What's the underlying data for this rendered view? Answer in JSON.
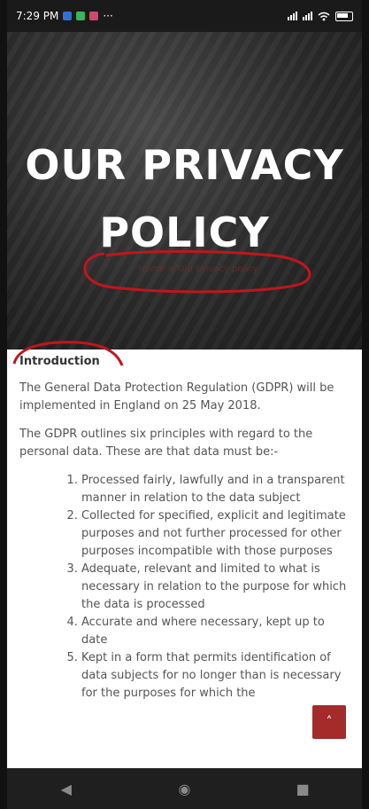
{
  "status_bar": {
    "time": "7:29 PM",
    "dots": "···"
  },
  "hero": {
    "title_line1": "OUR PRIVACY",
    "title_line2": "POLICY",
    "subtitle": "Home > Our privacy policy"
  },
  "content": {
    "section_title": "Introduction",
    "para1": "The General Data Protection Regulation (GDPR) will be implemented in England on 25 May 2018.",
    "para2": "The GDPR outlines six principles with regard to the personal data.  These are that data must be:-",
    "list": [
      "Processed fairly, lawfully and in a transparent manner in relation to the data subject",
      "Collected for specified, explicit and legitimate purposes and not further processed for other purposes incompatible with those purposes",
      "Adequate, relevant and limited to what is necessary in relation to the purpose for which the data is processed",
      "Accurate and where necessary, kept up to date",
      "Kept in a form that permits identification of data subjects for no longer than is necessary for the purposes for which the"
    ]
  },
  "scroll_top": {
    "icon": "chevron-up-icon",
    "glyph": "˄"
  },
  "nav": {
    "back_glyph": "◀",
    "home_glyph": "◉",
    "recents_glyph": "■"
  },
  "colors": {
    "accent": "#a52a2a",
    "annotation_red": "#c0161b"
  }
}
